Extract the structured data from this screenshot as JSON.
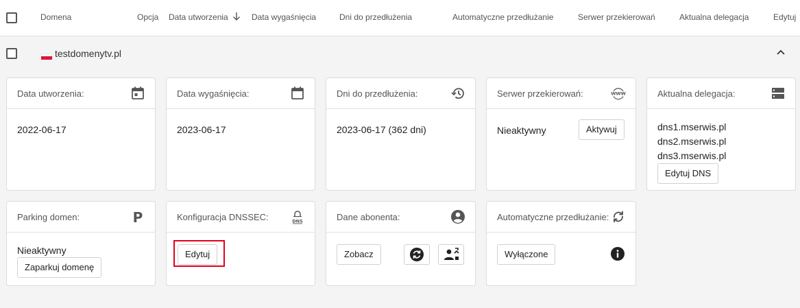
{
  "header": {
    "columns": {
      "domain": "Domena",
      "option": "Opcja",
      "created": "Data utworzenia",
      "expires": "Data wygaśnięcia",
      "days": "Dni do przedłużenia",
      "auto": "Automatyczne przedłużanie",
      "redirect": "Serwer przekierowań",
      "delegation": "Aktualna delegacja",
      "edit": "Edytuj"
    }
  },
  "domain": {
    "name": "testdomenytv.pl"
  },
  "cards": {
    "created": {
      "title": "Data utworzenia:",
      "value": "2022-06-17",
      "icon": "calendar-icon"
    },
    "expires": {
      "title": "Data wygaśnięcia:",
      "value": "2023-06-17",
      "icon": "calendar-blank-icon"
    },
    "days": {
      "title": "Dni do przedłużenia:",
      "value": "2023-06-17 (362 dni)",
      "icon": "history-icon"
    },
    "redirect": {
      "title": "Serwer przekierowań:",
      "value": "Nieaktywny",
      "button": "Aktywuj",
      "icon": "www-icon"
    },
    "delegation": {
      "title": "Aktualna delegacja:",
      "servers": [
        "dns1.mserwis.pl",
        "dns2.mserwis.pl",
        "dns3.mserwis.pl"
      ],
      "button": "Edytuj DNS",
      "icon": "server-icon"
    },
    "parking": {
      "title": "Parking domen:",
      "value": "Nieaktywny",
      "button": "Zaparkuj domenę",
      "icon": "parking-icon"
    },
    "dnssec": {
      "title": "Konfiguracja DNSSEC:",
      "button": "Edytuj",
      "icon": "dns-lock-icon"
    },
    "subscriber": {
      "title": "Dane abonenta:",
      "button": "Zobacz",
      "icon": "account-circle-icon"
    },
    "autorenew": {
      "title": "Automatyczne przedłużanie:",
      "button": "Wyłączone",
      "icon": "sync-icon"
    }
  },
  "colors": {
    "accent_highlight": "#e0001b",
    "icon": "#555555"
  }
}
